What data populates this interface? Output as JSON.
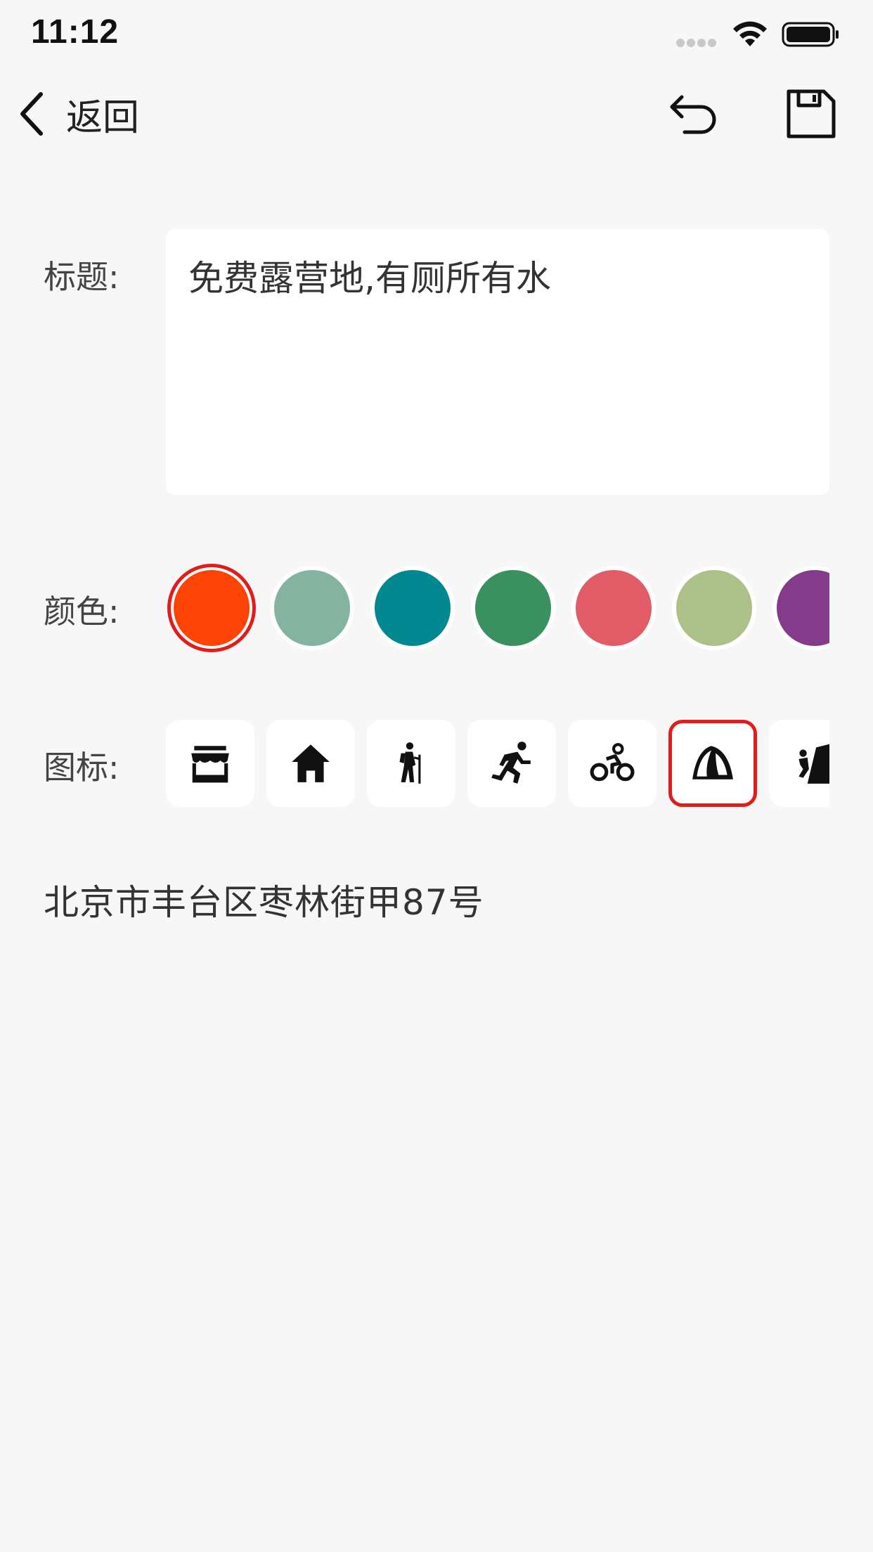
{
  "status_bar": {
    "time": "11:12"
  },
  "nav": {
    "back_label": "返回",
    "back_icon": "chevron-left-icon",
    "undo_icon": "undo-icon",
    "save_icon": "floppy-disk-icon"
  },
  "form": {
    "title_label": "标题:",
    "title_value": "免费露营地,有厕所有水",
    "color_label": "颜色:",
    "icon_label": "图标:"
  },
  "colors": {
    "options": [
      "#fe4306",
      "#84b4a0",
      "#028890",
      "#3b9060",
      "#e25c67",
      "#acc08a",
      "#843b8a"
    ],
    "selected_index": 0,
    "selection_ring": "#e21b1b"
  },
  "icons": {
    "options": [
      "store-icon",
      "house-icon",
      "hiking-icon",
      "running-icon",
      "cycling-icon",
      "tent-icon",
      "climbing-icon"
    ],
    "selected_index": 5
  },
  "address": "北京市丰台区枣林街甲87号"
}
